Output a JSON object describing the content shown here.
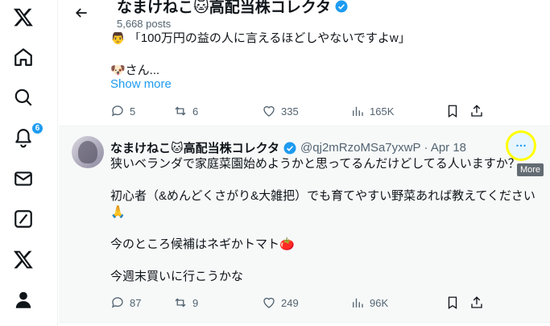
{
  "nav": {
    "notifications_badge": "6"
  },
  "header": {
    "title": "なまけねこ🐱高配当株コレクタ",
    "posts_count": "5,668 posts"
  },
  "tweet1": {
    "text_line1": "👨 「100万円の益の人に言えるほどしやないですよw」",
    "text_line2": "🐶さん...",
    "show_more": "Show more",
    "stats": {
      "replies": "5",
      "reposts": "6",
      "likes": "335",
      "views": "165K"
    }
  },
  "tweet2": {
    "name": "なまけねこ🐱高配当株コレクタ",
    "handle": "@qj2mRzoMSa7yxwP",
    "date": "· Apr 18",
    "paragraphs": [
      "狭いベランダで家庭菜園始めようかと思ってるんだけどしてる人いますか？",
      "初心者（&めんどくさがり&大雑把）でも育てやすい野菜あれば教えてください🙏",
      "今のところ候補はネギかトマト🍅",
      "今週末買いに行こうかな"
    ],
    "more_tooltip": "More",
    "stats": {
      "replies": "87",
      "reposts": "9",
      "likes": "249",
      "views": "96K"
    }
  },
  "colors": {
    "accent": "#1d9bf0",
    "highlight": "#ffff00"
  }
}
